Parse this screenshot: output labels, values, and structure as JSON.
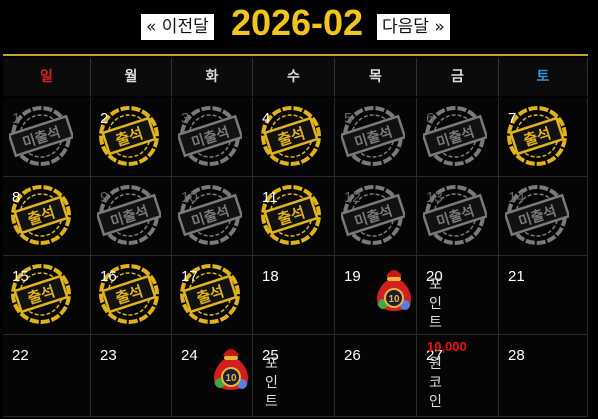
{
  "nav": {
    "prev_label": "« 이전달",
    "next_label": "다음달 »"
  },
  "month_title": "2026-02",
  "weekdays": [
    {
      "label": "일",
      "color": "#e02020"
    },
    {
      "label": "월",
      "color": "#dddddd"
    },
    {
      "label": "화",
      "color": "#dddddd"
    },
    {
      "label": "수",
      "color": "#dddddd"
    },
    {
      "label": "목",
      "color": "#dddddd"
    },
    {
      "label": "금",
      "color": "#dddddd"
    },
    {
      "label": "토",
      "color": "#3a8fd8"
    }
  ],
  "stamps": {
    "attend": "출석",
    "absent": "미출석"
  },
  "days": [
    {
      "day": "1",
      "status": "absent"
    },
    {
      "day": "2",
      "status": "attend"
    },
    {
      "day": "3",
      "status": "absent"
    },
    {
      "day": "4",
      "status": "attend"
    },
    {
      "day": "5",
      "status": "absent"
    },
    {
      "day": "6",
      "status": "absent"
    },
    {
      "day": "7",
      "status": "attend"
    },
    {
      "day": "8",
      "status": "attend"
    },
    {
      "day": "9",
      "status": "absent"
    },
    {
      "day": "10",
      "status": "absent"
    },
    {
      "day": "11",
      "status": "attend"
    },
    {
      "day": "12",
      "status": "absent"
    },
    {
      "day": "13",
      "status": "absent"
    },
    {
      "day": "14",
      "status": "absent"
    },
    {
      "day": "15",
      "status": "attend"
    },
    {
      "day": "16",
      "status": "attend"
    },
    {
      "day": "17",
      "status": "attend"
    },
    {
      "day": "18",
      "status": "none"
    },
    {
      "day": "19",
      "status": "none"
    },
    {
      "day": "20",
      "status": "none"
    },
    {
      "day": "21",
      "status": "none"
    },
    {
      "day": "22",
      "status": "none"
    },
    {
      "day": "23",
      "status": "none"
    },
    {
      "day": "24",
      "status": "none"
    },
    {
      "day": "25",
      "status": "none"
    },
    {
      "day": "26",
      "status": "none"
    },
    {
      "day": "27",
      "status": "none"
    },
    {
      "day": "28",
      "status": "none"
    }
  ],
  "rewards": [
    {
      "on_day": "19",
      "badge": "10",
      "text": "포인트",
      "amount": "10,000",
      "unit": "원 코인"
    },
    {
      "on_day": "24",
      "badge": "10",
      "text": "포인트"
    }
  ],
  "colors": {
    "accent": "#f3c51b",
    "gold_stamp": "#e0b21c",
    "gray_stamp": "#7a7a7a",
    "amount": "#e11111"
  }
}
